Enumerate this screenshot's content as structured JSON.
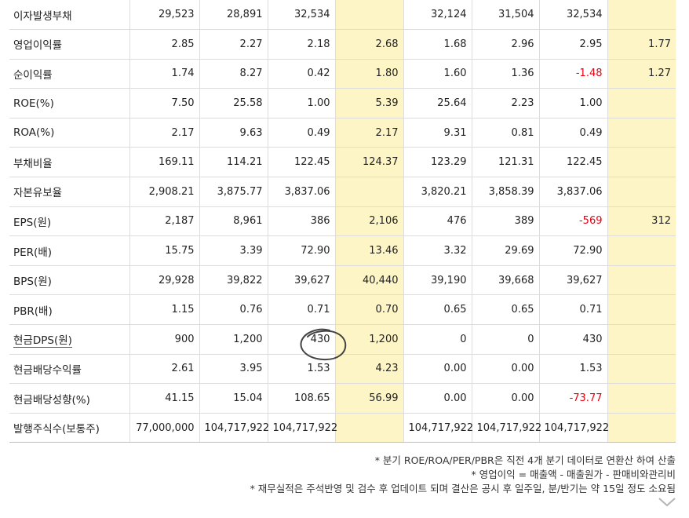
{
  "table": {
    "rows": [
      {
        "label": "이자발생부채",
        "values": [
          "29,523",
          "28,891",
          "32,534",
          "",
          "32,124",
          "31,504",
          "32,534",
          ""
        ]
      },
      {
        "label": "영업이익률",
        "values": [
          "2.85",
          "2.27",
          "2.18",
          "2.68",
          "1.68",
          "2.96",
          "2.95",
          "1.77"
        ]
      },
      {
        "label": "순이익률",
        "values": [
          "1.74",
          "8.27",
          "0.42",
          "1.80",
          "1.60",
          "1.36",
          "-1.48",
          "1.27"
        ]
      },
      {
        "label": "ROE(%)",
        "values": [
          "7.50",
          "25.58",
          "1.00",
          "5.39",
          "25.64",
          "2.23",
          "1.00",
          ""
        ]
      },
      {
        "label": "ROA(%)",
        "values": [
          "2.17",
          "9.63",
          "0.49",
          "2.17",
          "9.31",
          "0.81",
          "0.49",
          ""
        ]
      },
      {
        "label": "부채비율",
        "values": [
          "169.11",
          "114.21",
          "122.45",
          "124.37",
          "123.29",
          "121.31",
          "122.45",
          ""
        ]
      },
      {
        "label": "자본유보율",
        "values": [
          "2,908.21",
          "3,875.77",
          "3,837.06",
          "",
          "3,820.21",
          "3,858.39",
          "3,837.06",
          ""
        ]
      },
      {
        "label": "EPS(원)",
        "values": [
          "2,187",
          "8,961",
          "386",
          "2,106",
          "476",
          "389",
          "-569",
          "312"
        ]
      },
      {
        "label": "PER(배)",
        "values": [
          "15.75",
          "3.39",
          "72.90",
          "13.46",
          "3.32",
          "29.69",
          "72.90",
          ""
        ]
      },
      {
        "label": "BPS(원)",
        "values": [
          "29,928",
          "39,822",
          "39,627",
          "40,440",
          "39,190",
          "39,668",
          "39,627",
          ""
        ]
      },
      {
        "label": "PBR(배)",
        "values": [
          "1.15",
          "0.76",
          "0.71",
          "0.70",
          "0.65",
          "0.65",
          "0.71",
          ""
        ]
      },
      {
        "label": "현금DPS(원)",
        "values": [
          "900",
          "1,200",
          "430",
          "1,200",
          "0",
          "0",
          "430",
          ""
        ]
      },
      {
        "label": "현금배당수익률",
        "values": [
          "2.61",
          "3.95",
          "1.53",
          "4.23",
          "0.00",
          "0.00",
          "1.53",
          ""
        ]
      },
      {
        "label": "현금배당성향(%)",
        "values": [
          "41.15",
          "15.04",
          "108.65",
          "56.99",
          "0.00",
          "0.00",
          "-73.77",
          ""
        ]
      },
      {
        "label": "발행주식수(보통주)",
        "values": [
          "77,000,000",
          "104,717,922",
          "104,717,922",
          "",
          "104,717,922",
          "104,717,922",
          "104,717,922",
          ""
        ]
      }
    ]
  },
  "notes": [
    "* 분기 ROE/ROA/PER/PBR은 직전 4개 분기 데이터로 연환산 하여 산출",
    "* 영업이익 = 매출액 - 매출원가 - 판매비와관리비",
    "* 재무실적은 주석반영 및 검수 후 업데이트 되며 결산은 공시 후 일주일, 분/반기는 약 15일 정도 소요됨"
  ],
  "colors": {
    "highlight": "#fdf5c6",
    "negative": "#e60012",
    "grid": "#dcdcdc"
  },
  "icons": {
    "expand": "chevron-down-icon"
  }
}
